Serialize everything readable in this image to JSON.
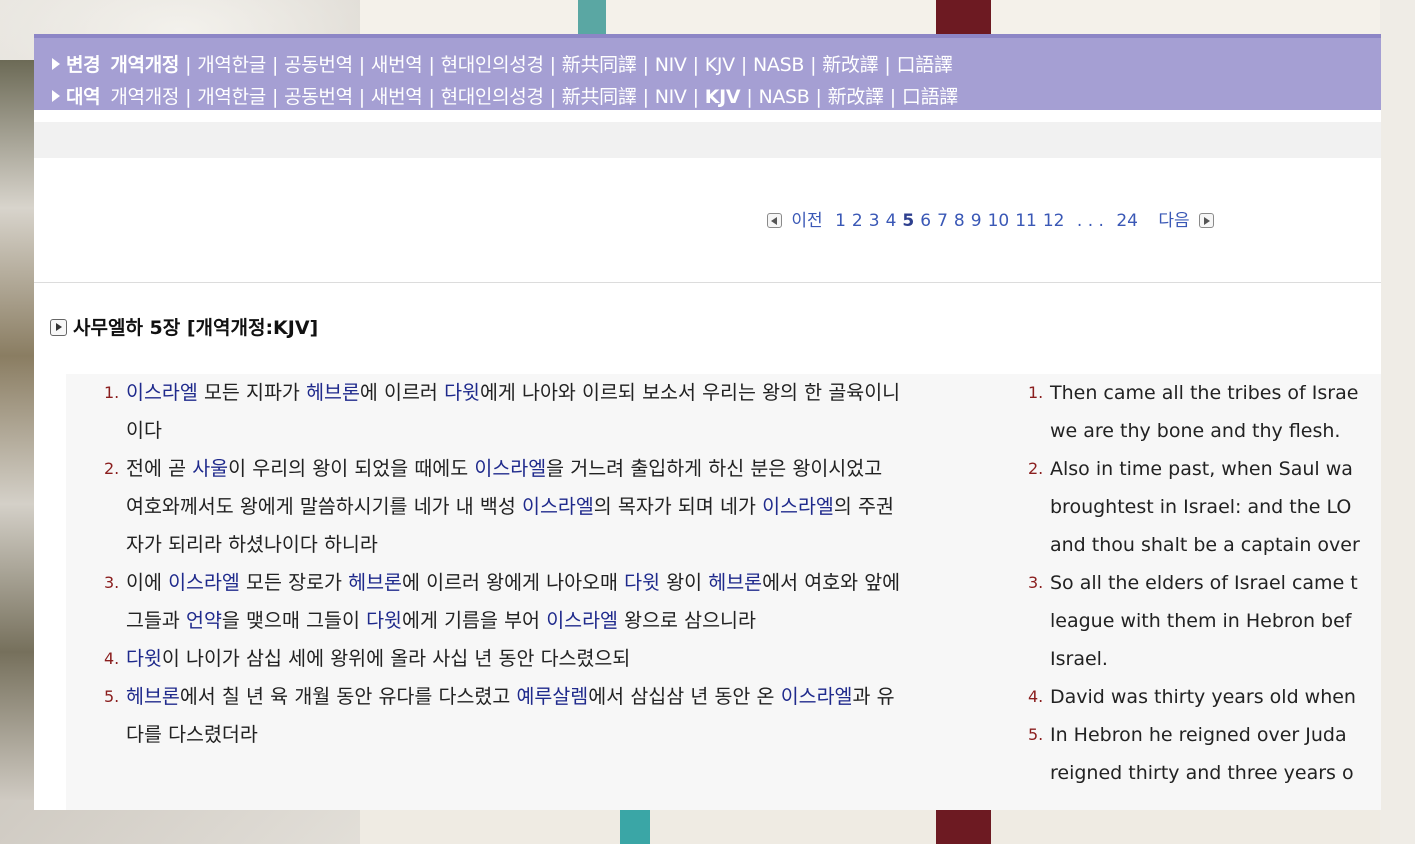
{
  "nav": {
    "row1": {
      "label": "변경",
      "items": [
        "개역개정",
        "개역한글",
        "공동번역",
        "새번역",
        "현대인의성경",
        "新共同譯",
        "NIV",
        "KJV",
        "NASB",
        "新改譯",
        "口語譯"
      ],
      "active": "개역개정"
    },
    "row2": {
      "label": "대역",
      "items": [
        "개역개정",
        "개역한글",
        "공동번역",
        "새번역",
        "현대인의성경",
        "新共同譯",
        "NIV",
        "KJV",
        "NASB",
        "新改譯",
        "口語譯"
      ],
      "active": "KJV"
    }
  },
  "pager": {
    "prev": "이전",
    "pages": [
      "1",
      "2",
      "3",
      "4",
      "5",
      "6",
      "7",
      "8",
      "9",
      "10",
      "11",
      "12"
    ],
    "current": "5",
    "ellipsis": ". . .",
    "last": "24",
    "next": "다음"
  },
  "chapter_title": "사무엘하 5장 [개역개정:KJV]",
  "korean_verses": [
    {
      "num": "1.",
      "lines": [
        [
          {
            "t": "이스라엘",
            "n": true
          },
          {
            "t": " 모든 지파가 "
          },
          {
            "t": "헤브론",
            "n": true
          },
          {
            "t": "에 이르러 "
          },
          {
            "t": "다윗",
            "n": true
          },
          {
            "t": "에게 나아와 이르되 보소서 우리는 왕의 한 골육이니"
          }
        ],
        [
          {
            "t": "이다"
          }
        ]
      ]
    },
    {
      "num": "2.",
      "lines": [
        [
          {
            "t": "전에 곧 "
          },
          {
            "t": "사울",
            "n": true
          },
          {
            "t": "이 우리의 왕이 되었을 때에도 "
          },
          {
            "t": "이스라엘",
            "n": true
          },
          {
            "t": "을 거느려 출입하게 하신 분은 왕이시었고"
          }
        ],
        [
          {
            "t": "여호와께서도 왕에게 말씀하시기를 네가 내 백성 "
          },
          {
            "t": "이스라엘",
            "n": true
          },
          {
            "t": "의 목자가 되며 네가 "
          },
          {
            "t": "이스라엘",
            "n": true
          },
          {
            "t": "의 주권"
          }
        ],
        [
          {
            "t": "자가 되리라 하셨나이다 하니라"
          }
        ]
      ]
    },
    {
      "num": "3.",
      "lines": [
        [
          {
            "t": "이에 "
          },
          {
            "t": "이스라엘",
            "n": true
          },
          {
            "t": " 모든 장로가 "
          },
          {
            "t": "헤브론",
            "n": true
          },
          {
            "t": "에 이르러 왕에게 나아오매 "
          },
          {
            "t": "다윗",
            "n": true
          },
          {
            "t": " 왕이 "
          },
          {
            "t": "헤브론",
            "n": true
          },
          {
            "t": "에서 여호와 앞에"
          }
        ],
        [
          {
            "t": "그들과 "
          },
          {
            "t": "언약",
            "n": true
          },
          {
            "t": "을 맺으매 그들이 "
          },
          {
            "t": "다윗",
            "n": true
          },
          {
            "t": "에게 기름을 부어 "
          },
          {
            "t": "이스라엘",
            "n": true
          },
          {
            "t": " 왕으로 삼으니라"
          }
        ]
      ]
    },
    {
      "num": "4.",
      "lines": [
        [
          {
            "t": "다윗",
            "n": true
          },
          {
            "t": "이 나이가 삼십 세에 왕위에 올라 사십 년 동안 다스렸으되"
          }
        ]
      ]
    },
    {
      "num": "5.",
      "lines": [
        [
          {
            "t": "헤브론",
            "n": true
          },
          {
            "t": "에서 칠 년 육 개월 동안 유다를 다스렸고 "
          },
          {
            "t": "예루살렘",
            "n": true
          },
          {
            "t": "에서 삼십삼 년 동안 온 "
          },
          {
            "t": "이스라엘",
            "n": true
          },
          {
            "t": "과 유"
          }
        ],
        [
          {
            "t": "다를 다스렸더라"
          }
        ]
      ]
    }
  ],
  "english_verses": [
    {
      "num": "1.",
      "lines": [
        "Then came all the tribes of Israe",
        "we are thy bone and thy flesh."
      ]
    },
    {
      "num": "2.",
      "lines": [
        "Also in time past, when Saul wa",
        "broughtest in Israel: and the LO",
        "and thou shalt be a captain over"
      ]
    },
    {
      "num": "3.",
      "lines": [
        "So all the elders of Israel came t",
        "league with them in Hebron bef",
        "Israel."
      ]
    },
    {
      "num": "4.",
      "lines": [
        "David was thirty years old when"
      ]
    },
    {
      "num": "5.",
      "lines": [
        "In Hebron he reigned over Juda",
        "reigned thirty and three years o"
      ]
    }
  ],
  "colors": {
    "topbar": "#a59fd3",
    "name_link": "#1f2a8c",
    "verse_num": "#8a1e1e",
    "pager_link": "#3a58b6"
  }
}
